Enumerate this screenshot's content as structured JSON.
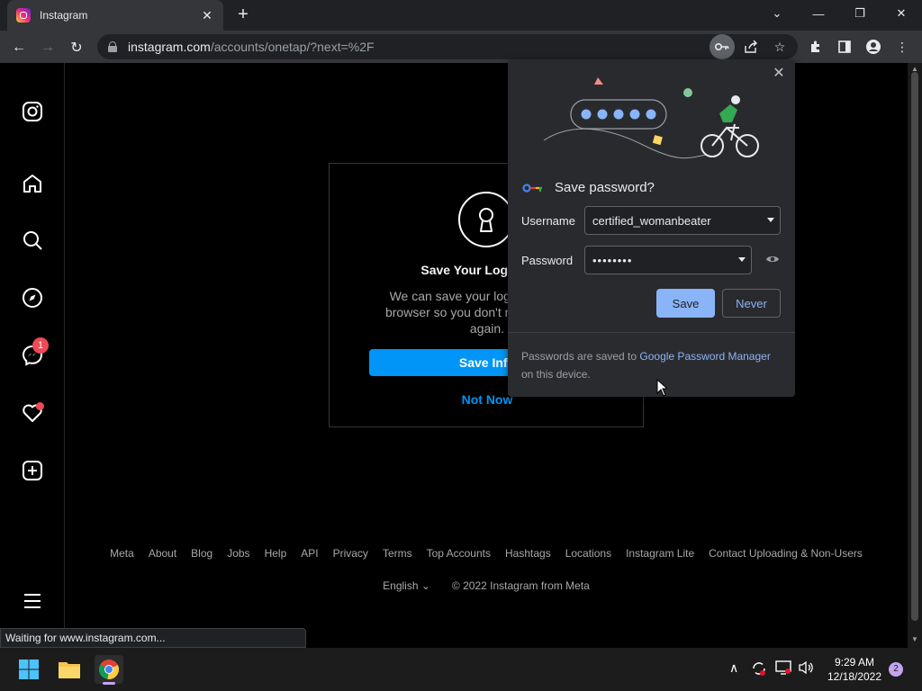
{
  "browser": {
    "tab_title": "Instagram",
    "url_host": "instagram.com",
    "url_path": "/accounts/onetap/?next=%2F",
    "status_text": "Waiting for www.instagram.com..."
  },
  "ig_dialog": {
    "title": "Save Your Login Info?",
    "body": "We can save your login info on this browser so you don't need to enter it again.",
    "save_button": "Save Info",
    "not_now": "Not Now"
  },
  "leftnav": {
    "messages_badge": "1"
  },
  "footer": {
    "links": [
      "Meta",
      "About",
      "Blog",
      "Jobs",
      "Help",
      "API",
      "Privacy",
      "Terms",
      "Top Accounts",
      "Hashtags",
      "Locations",
      "Instagram Lite",
      "Contact Uploading & Non-Users"
    ],
    "language": "English",
    "copyright": "© 2022 Instagram from Meta"
  },
  "password_bubble": {
    "title": "Save password?",
    "username_label": "Username",
    "username_value": "certified_womanbeater",
    "password_label": "Password",
    "password_value": "••••••••",
    "save_button": "Save",
    "never_button": "Never",
    "footer_prefix": "Passwords are saved to ",
    "footer_link": "Google Password Manager",
    "footer_suffix": " on this device."
  },
  "taskbar": {
    "time": "9:29 AM",
    "date": "12/18/2022",
    "notification_count": "2"
  },
  "colors": {
    "instagram_blue": "#0095f6",
    "chrome_accent": "#8ab4f8",
    "notification_red": "#ed4956"
  }
}
